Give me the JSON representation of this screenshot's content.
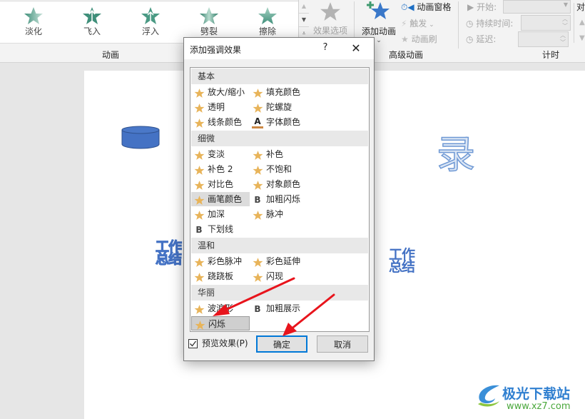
{
  "ribbon": {
    "gallery": [
      {
        "label": "淡化",
        "icon": "fade-star-icon"
      },
      {
        "label": "飞入",
        "icon": "fly-in-star-icon"
      },
      {
        "label": "浮入",
        "icon": "float-in-star-icon"
      },
      {
        "label": "劈裂",
        "icon": "split-star-icon"
      },
      {
        "label": "擦除",
        "icon": "wipe-star-icon"
      }
    ],
    "groups": {
      "animation": "动画",
      "advanced": "高级动画",
      "timing": "计时"
    },
    "effect_options": "效果选项",
    "add_animation": "添加动画",
    "animation_pane": "动画窗格",
    "trigger": "触发",
    "animation_painter": "动画刷",
    "start_label": "开始:",
    "duration_label": "持续时间:",
    "delay_label": "延迟:",
    "reorder_label": "对"
  },
  "slide": {
    "text_left": "工作总结",
    "text_right": "工作总结",
    "text_big": "录"
  },
  "dialog": {
    "title": "添加强调效果",
    "help": "?",
    "close": "✕",
    "categories": [
      {
        "name": "基本",
        "items": [
          {
            "label": "放大/缩小",
            "icon": "star"
          },
          {
            "label": "填充颜色",
            "icon": "star"
          },
          {
            "label": "透明",
            "icon": "star"
          },
          {
            "label": "陀螺旋",
            "icon": "star"
          },
          {
            "label": "线条颜色",
            "icon": "star"
          },
          {
            "label": "字体颜色",
            "icon": "font-color"
          }
        ]
      },
      {
        "name": "细微",
        "items": [
          {
            "label": "变淡",
            "icon": "star"
          },
          {
            "label": "补色",
            "icon": "star"
          },
          {
            "label": "补色 2",
            "icon": "star"
          },
          {
            "label": "不饱和",
            "icon": "star"
          },
          {
            "label": "对比色",
            "icon": "star"
          },
          {
            "label": "对象颜色",
            "icon": "star"
          },
          {
            "label": "画笔颜色",
            "icon": "star"
          },
          {
            "label": "加粗闪烁",
            "icon": "bold"
          },
          {
            "label": "加深",
            "icon": "star"
          },
          {
            "label": "脉冲",
            "icon": "star"
          },
          {
            "label": "下划线",
            "icon": "bold"
          }
        ]
      },
      {
        "name": "温和",
        "items": [
          {
            "label": "彩色脉冲",
            "icon": "star"
          },
          {
            "label": "彩色延伸",
            "icon": "star"
          },
          {
            "label": "跷跷板",
            "icon": "star"
          },
          {
            "label": "闪现",
            "icon": "star"
          }
        ]
      },
      {
        "name": "华丽",
        "items": [
          {
            "label": "波浪形",
            "icon": "star"
          },
          {
            "label": "加粗展示",
            "icon": "bold"
          },
          {
            "label": "闪烁",
            "icon": "star"
          }
        ]
      }
    ],
    "selected": "闪烁",
    "hovered": "画笔颜色",
    "preview_label": "预览效果(P)",
    "preview_checked": true,
    "ok": "确定",
    "cancel": "取消"
  },
  "colors": {
    "star": "#e8b45a",
    "accent": "#0078d7",
    "arrow": "#e8141c",
    "slide_text": "#4472c4"
  },
  "watermark": {
    "name": "极光下载站",
    "url": "www.xz7.com"
  }
}
